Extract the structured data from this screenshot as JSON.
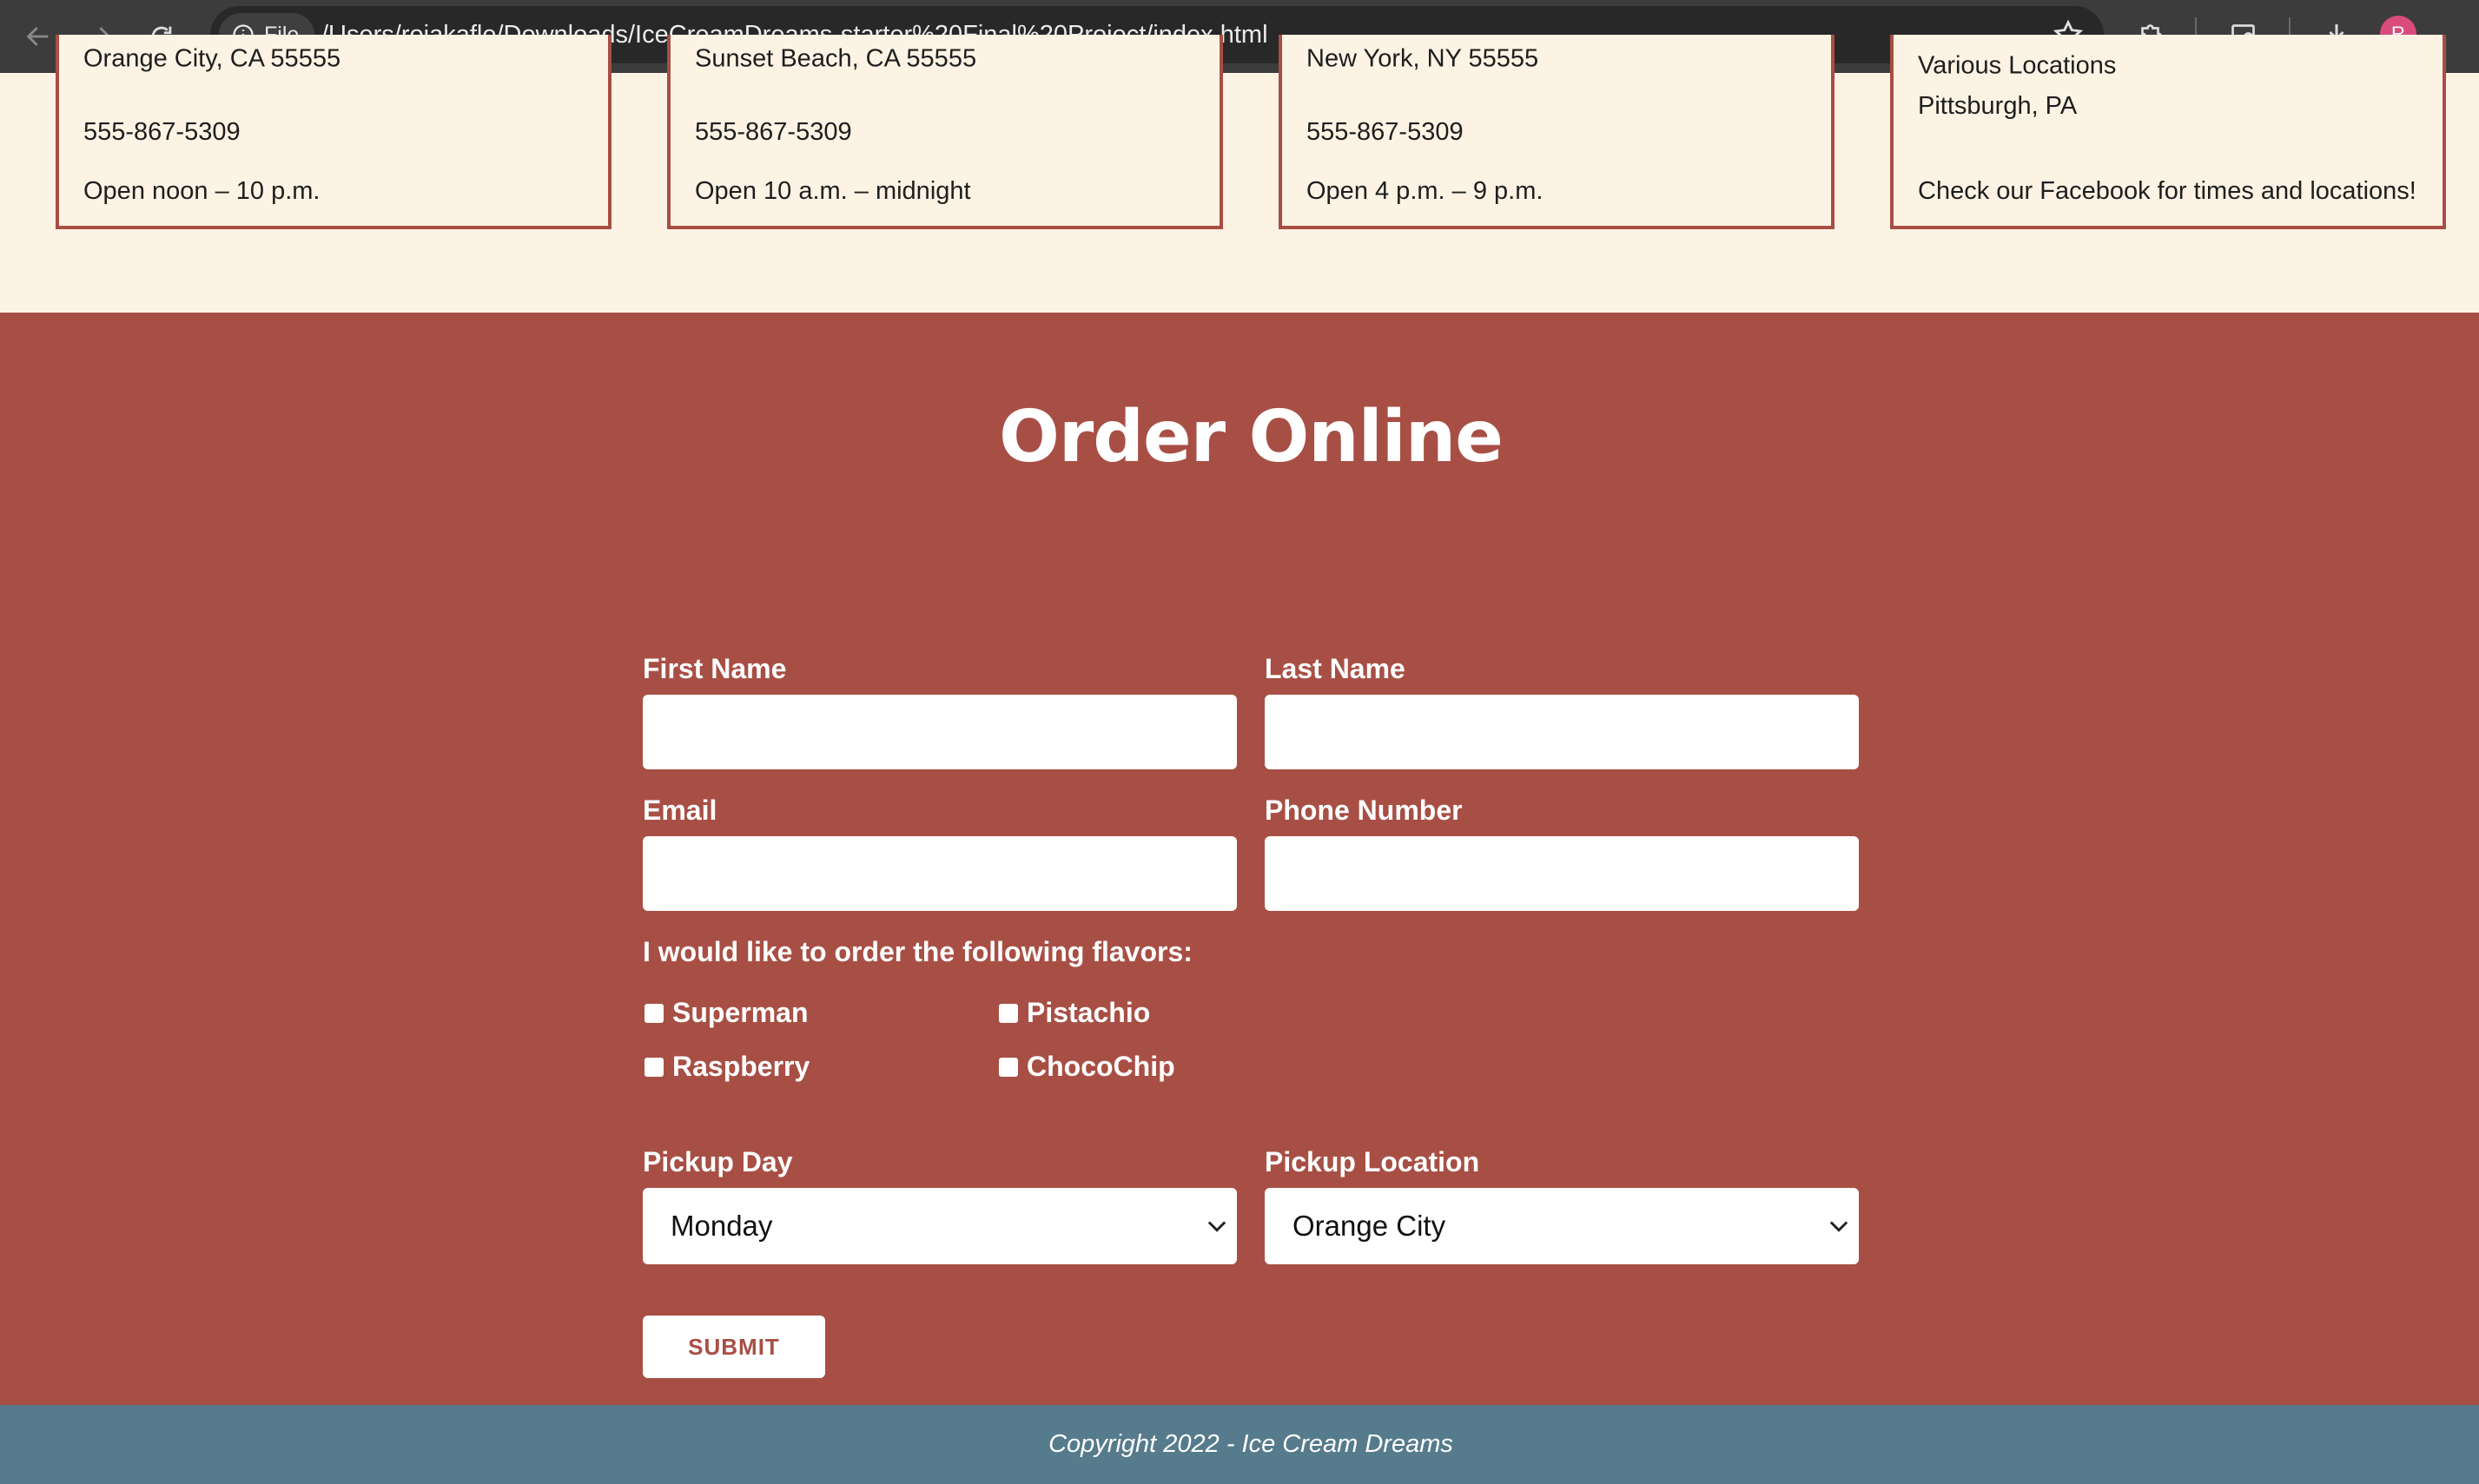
{
  "browser": {
    "file_chip_label": "File",
    "url": "/Users/rojakafle/Downloads/IceCreamDreams-starter%20Final%20Project/index.html",
    "avatar_initial": "R"
  },
  "locations": [
    {
      "cut_line": "Orange City, CA 55555",
      "line2": "555-867-5309",
      "line3": "Open noon – 10 p.m."
    },
    {
      "cut_line": "Sunset Beach, CA 55555",
      "line2": "555-867-5309",
      "line3": "Open 10 a.m. – midnight"
    },
    {
      "cut_line": "New York, NY 55555",
      "line2": "555-867-5309",
      "line3": "Open 4 p.m. – 9 p.m."
    },
    {
      "cut_line": "Various Locations",
      "line2": "Pittsburgh, PA",
      "line3": "Check our Facebook for times and locations!"
    }
  ],
  "order": {
    "title": "Order Online",
    "first_name_label": "First Name",
    "last_name_label": "Last Name",
    "email_label": "Email",
    "phone_label": "Phone Number",
    "flavors_prompt": "I would like to order the following flavors:",
    "flavors": [
      "Superman",
      "Pistachio",
      "Raspberry",
      "ChocoChip"
    ],
    "pickup_day_label": "Pickup Day",
    "pickup_day_value": "Monday",
    "pickup_location_label": "Pickup Location",
    "pickup_location_value": "Orange City",
    "submit_label": "SUBMIT"
  },
  "footer": {
    "copyright": "Copyright 2022 - Ice Cream Dreams"
  }
}
